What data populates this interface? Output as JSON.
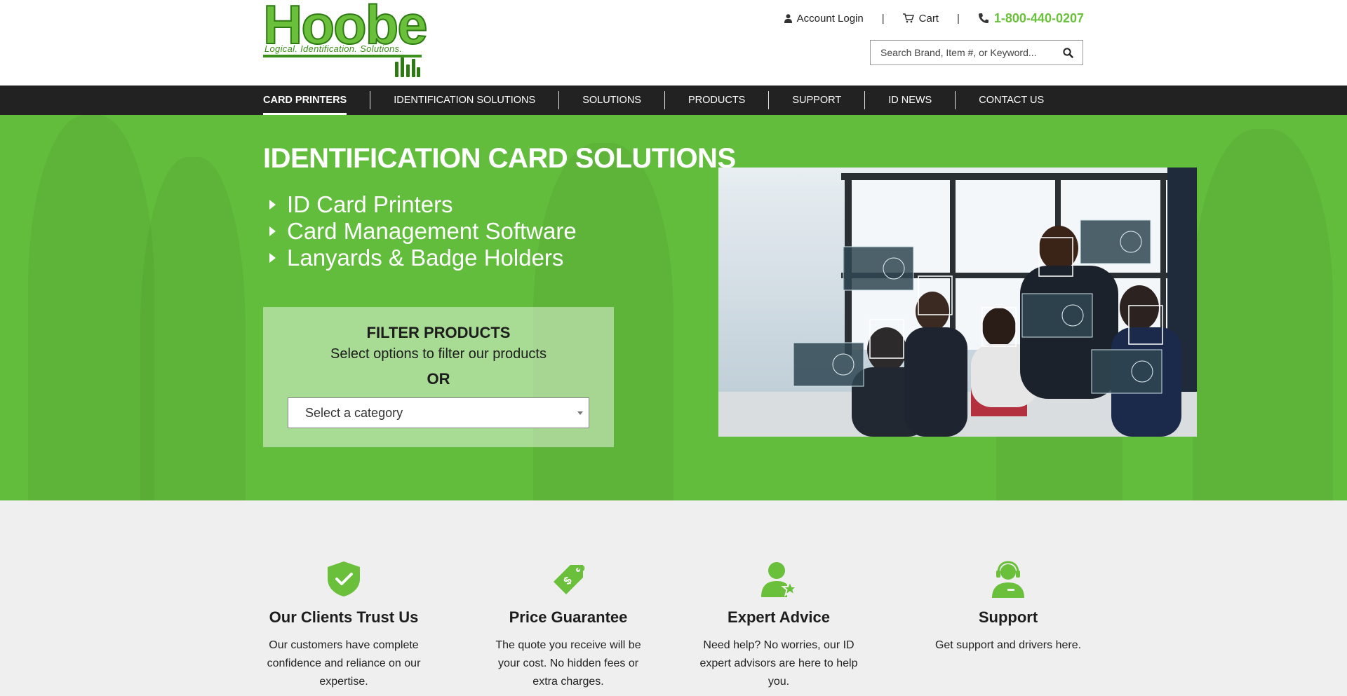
{
  "brand": {
    "logo_text": "Hoobe",
    "tagline": "Logical. Identification. Solutions.",
    "accent_color": "#6abf3b",
    "dark_color": "#222222"
  },
  "header": {
    "account_label": "Account Login",
    "cart_label": "Cart",
    "separator": "|",
    "phone": "1-800-440-0207",
    "search_placeholder": "Search Brand, Item #, or Keyword..."
  },
  "nav": {
    "items": [
      {
        "label": "CARD PRINTERS",
        "active": true
      },
      {
        "label": "IDENTIFICATION SOLUTIONS"
      },
      {
        "label": "SOLUTIONS"
      },
      {
        "label": "PRODUCTS"
      },
      {
        "label": "SUPPORT"
      },
      {
        "label": "ID NEWS"
      },
      {
        "label": "CONTACT US"
      }
    ]
  },
  "hero": {
    "title": "IDENTIFICATION CARD SOLUTIONS",
    "links": [
      "ID Card Printers",
      "Card Management Software",
      "Lanyards & Badge Holders"
    ],
    "filter": {
      "title": "FILTER PRODUCTS",
      "subtitle": "Select options to filter our products",
      "or": "OR",
      "select_value": "Select a category"
    }
  },
  "features": [
    {
      "icon": "shield-check-icon",
      "title": "Our Clients Trust Us",
      "text": "Our customers have complete confidence and reliance on our expertise."
    },
    {
      "icon": "price-tag-icon",
      "title": "Price Guarantee",
      "text": "The quote you receive will be your cost. No hidden fees or extra charges."
    },
    {
      "icon": "expert-user-icon",
      "title": "Expert Advice",
      "text": "Need help? No worries, our ID expert advisors are here to help you."
    },
    {
      "icon": "headset-support-icon",
      "title": "Support",
      "text": "Get support and drivers here."
    }
  ]
}
